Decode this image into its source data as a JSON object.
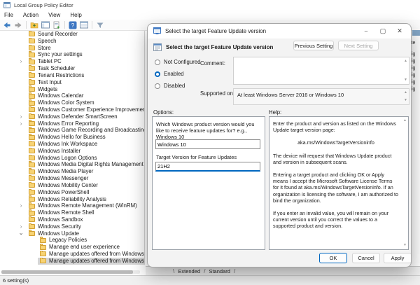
{
  "window": {
    "title": "Local Group Policy Editor"
  },
  "menu": {
    "items": [
      "File",
      "Action",
      "View",
      "Help"
    ]
  },
  "toolbar": {
    "icons": [
      "back",
      "forward",
      "sep",
      "folder-up",
      "console-tree",
      "export-list",
      "sep",
      "help",
      "show-window",
      "sep",
      "filter"
    ]
  },
  "tree": {
    "items": [
      {
        "label": "Sound Recorder",
        "level": 0,
        "state": "none",
        "selected": false
      },
      {
        "label": "Speech",
        "level": 0,
        "state": "none",
        "selected": false
      },
      {
        "label": "Store",
        "level": 0,
        "state": "none",
        "selected": false
      },
      {
        "label": "Sync your settings",
        "level": 0,
        "state": "none",
        "selected": false
      },
      {
        "label": "Tablet PC",
        "level": 0,
        "state": "collapsed",
        "selected": false
      },
      {
        "label": "Task Scheduler",
        "level": 0,
        "state": "none",
        "selected": false
      },
      {
        "label": "Tenant Restrictions",
        "level": 0,
        "state": "none",
        "selected": false
      },
      {
        "label": "Text Input",
        "level": 0,
        "state": "none",
        "selected": false
      },
      {
        "label": "Widgets",
        "level": 0,
        "state": "none",
        "selected": false
      },
      {
        "label": "Windows Calendar",
        "level": 0,
        "state": "none",
        "selected": false
      },
      {
        "label": "Windows Color System",
        "level": 0,
        "state": "none",
        "selected": false
      },
      {
        "label": "Windows Customer Experience Improvement Program",
        "level": 0,
        "state": "none",
        "selected": false
      },
      {
        "label": "Windows Defender SmartScreen",
        "level": 0,
        "state": "collapsed",
        "selected": false
      },
      {
        "label": "Windows Error Reporting",
        "level": 0,
        "state": "collapsed",
        "selected": false
      },
      {
        "label": "Windows Game Recording and Broadcasting",
        "level": 0,
        "state": "none",
        "selected": false
      },
      {
        "label": "Windows Hello for Business",
        "level": 0,
        "state": "none",
        "selected": false
      },
      {
        "label": "Windows Ink Workspace",
        "level": 0,
        "state": "none",
        "selected": false
      },
      {
        "label": "Windows Installer",
        "level": 0,
        "state": "none",
        "selected": false
      },
      {
        "label": "Windows Logon Options",
        "level": 0,
        "state": "none",
        "selected": false
      },
      {
        "label": "Windows Media Digital Rights Management",
        "level": 0,
        "state": "none",
        "selected": false
      },
      {
        "label": "Windows Media Player",
        "level": 0,
        "state": "none",
        "selected": false
      },
      {
        "label": "Windows Messenger",
        "level": 0,
        "state": "none",
        "selected": false
      },
      {
        "label": "Windows Mobility Center",
        "level": 0,
        "state": "none",
        "selected": false
      },
      {
        "label": "Windows PowerShell",
        "level": 0,
        "state": "none",
        "selected": false
      },
      {
        "label": "Windows Reliability Analysis",
        "level": 0,
        "state": "none",
        "selected": false
      },
      {
        "label": "Windows Remote Management (WinRM)",
        "level": 0,
        "state": "collapsed",
        "selected": false
      },
      {
        "label": "Windows Remote Shell",
        "level": 0,
        "state": "none",
        "selected": false
      },
      {
        "label": "Windows Sandbox",
        "level": 0,
        "state": "none",
        "selected": false
      },
      {
        "label": "Windows Security",
        "level": 0,
        "state": "collapsed",
        "selected": false
      },
      {
        "label": "Windows Update",
        "level": 0,
        "state": "expanded",
        "selected": false
      },
      {
        "label": "Legacy Policies",
        "level": 1,
        "state": "none",
        "selected": false
      },
      {
        "label": "Manage end user experience",
        "level": 1,
        "state": "none",
        "selected": false
      },
      {
        "label": "Manage updates offered from Windows Server Update Service",
        "level": 1,
        "state": "none",
        "selected": false
      },
      {
        "label": "Manage updates offered from Windows Update",
        "level": 1,
        "state": "none",
        "selected": true
      }
    ]
  },
  "background_fragments": {
    "items": [
      "ite",
      "fig",
      "fig",
      "fig",
      "fig",
      "fig",
      "fig"
    ]
  },
  "tabs": {
    "items": [
      "Extended",
      "Standard"
    ]
  },
  "statusbar": {
    "text": "6 setting(s)"
  },
  "dialog": {
    "title": "Select the target Feature Update version",
    "heading": "Select the target Feature Update version",
    "window_controls": {
      "minimize": "–",
      "maximize": "▢",
      "close": "✕"
    },
    "buttons": {
      "previous": "Previous Setting",
      "next": "Next Setting",
      "ok": "OK",
      "cancel": "Cancel",
      "apply": "Apply"
    },
    "radios": [
      {
        "label": "Not Configured",
        "selected": false
      },
      {
        "label": "Enabled",
        "selected": true
      },
      {
        "label": "Disabled",
        "selected": false
      }
    ],
    "comment_label": "Comment:",
    "comment_value": "",
    "supported_label": "Supported on:",
    "supported_value": "At least Windows Server 2016 or Windows 10",
    "options": {
      "label": "Options:",
      "question": "Which Windows product version would you like to receive feature updates for? e.g., Windows 10",
      "product_value": "Windows 10",
      "target_label": "Target Version for Feature Updates",
      "target_value": "21H2"
    },
    "help": {
      "label": "Help:",
      "paragraphs": [
        {
          "text": "Enter the product and version as listed on the Windows Update target version page:",
          "align": "left"
        },
        {
          "text": "aka.ms/WindowsTargetVersioninfo",
          "align": "center"
        },
        {
          "text": "The device will request that Windows Update product and version in subsequent scans.",
          "align": "left"
        },
        {
          "text": "Entering a target product and clicking OK or Apply means I accept the Microsoft Software License Terms for it found at aka.ms/WindowsTargetVersioninfo. If an organization is licensing the software, I am authorized to bind the organization.",
          "align": "left"
        },
        {
          "text": "If you enter an invalid value, you will remain on your current version until you correct the values to a supported product and version.",
          "align": "left"
        }
      ]
    }
  },
  "colors": {
    "accent": "#0067c0",
    "folder": "#f7d374",
    "inactive_selection": "#d6d6d6",
    "peek_block": "#84a7c7"
  }
}
